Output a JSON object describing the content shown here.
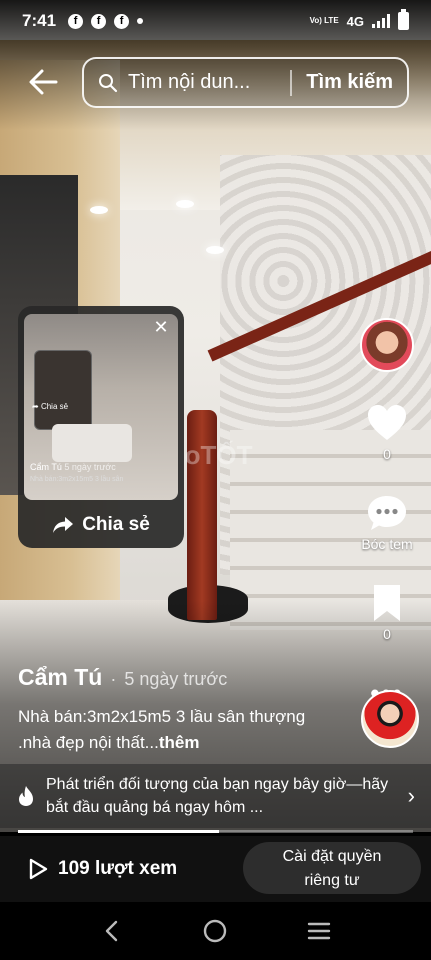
{
  "status_bar": {
    "time": "7:41",
    "network": "4G",
    "volte": "Vo) LTE",
    "notification_icons": [
      "facebook-icon",
      "facebook-icon",
      "facebook-icon"
    ]
  },
  "header": {
    "search_text": "Tìm nội dun...",
    "search_button": "Tìm kiếm"
  },
  "video": {
    "watermark": "ChoTỐT"
  },
  "share_popup": {
    "action_label": "Chia sẻ",
    "mini_share_label": "Chia sẻ",
    "mini_author": "Cẩm Tú",
    "mini_time": "5 ngày trước",
    "mini_desc": "Nhà bán:3m2x15m5 3 lầu sân"
  },
  "actions": {
    "like_count": "0",
    "comment_label": "Bóc tem",
    "save_count": "0"
  },
  "post": {
    "author": "Cẩm Tú",
    "separator": "·",
    "time": "5 ngày trước",
    "caption": "Nhà bán:3m2x15m5 3 lầu sân thượng .nhà đẹp nội  thất...",
    "more_label": "thêm"
  },
  "promo": {
    "text": "Phát triển đối tượng của bạn ngay bây giờ—hãy bắt đầu quảng bá ngay hôm ..."
  },
  "playback": {
    "progress": 0.51
  },
  "bottom_bar": {
    "views": "109 lượt xem",
    "privacy_line1": "Cài đặt quyền",
    "privacy_line2": "riêng tư"
  }
}
